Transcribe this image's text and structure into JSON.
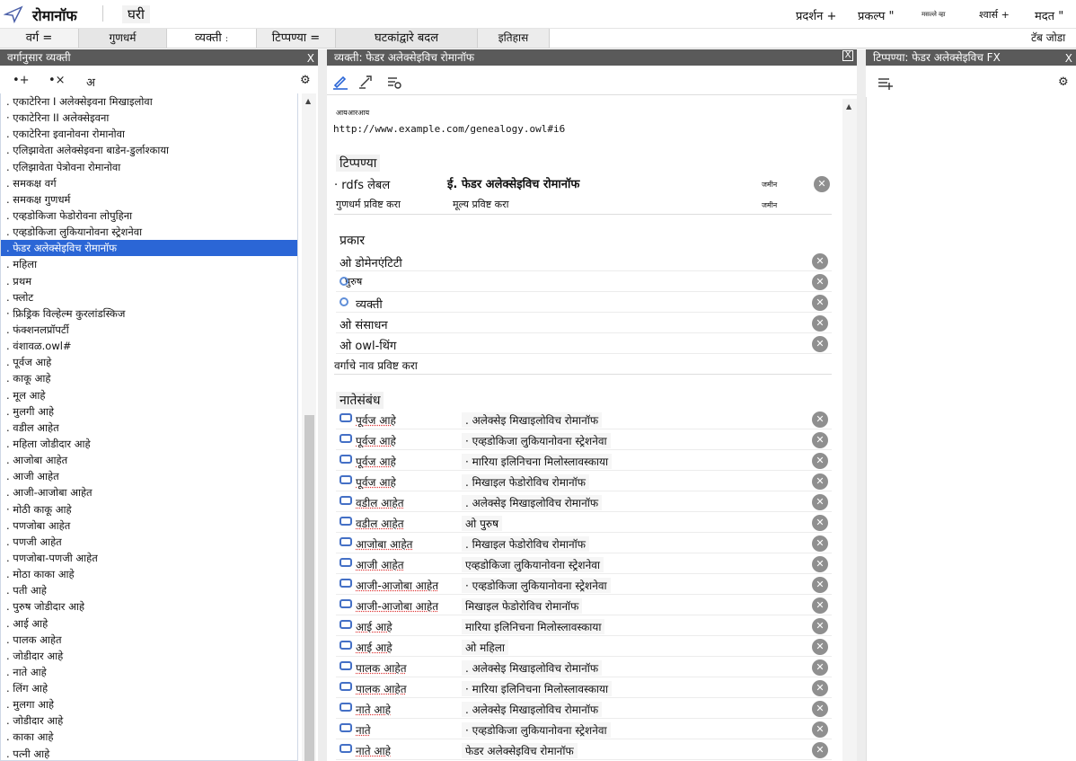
{
  "app": {
    "title": "रोमानॉफ",
    "home": "घरी"
  },
  "menus": {
    "display": "प्रदर्शन +",
    "project": "प्रकल्प \"",
    "tiny": "मसल्ले व्हा",
    "bookmarks": "श्वार्स +",
    "help": "मदत \""
  },
  "tabs": {
    "classes": "वर्ग =",
    "properties": "गुणधर्म",
    "individuals": "व्यक्ती",
    "individuals_mark": ":",
    "comments": "टिप्पण्या =",
    "changes": "घटकांद्वारे बदल",
    "history": "इतिहास",
    "add": "टॅब जोडा"
  },
  "left_panel": {
    "header": "वर्गानुसार व्यक्ती",
    "close": "X",
    "tools": {
      "add_individual": "•+",
      "delete_individual": "•×",
      "lang": "अ",
      "settings": "⚙"
    },
    "items": [
      ". एकाटेरिना I अलेक्सेइवना मिखाइलोवा",
      "· एकाटेरिना II अलेक्सेइवना",
      ". एकाटेरिना इवानोवना रोमानोवा",
      ". एलिझावेता अलेक्सेइवना बाडेन-डुर्लाश्काया",
      ". एलिझावेता पेत्रोवना रोमानोवा",
      ". समकक्ष वर्ग",
      ". समकक्ष गुणधर्म",
      ". एव्हडोकिजा फेडोरोवना लोपुहिना",
      ". एव्हडोकिजा लुकियानोवना स्ट्रेशनेवा",
      ". फेडर अलेक्सेइविच रोमानॉफ",
      ". महिला",
      ". प्रथम",
      ". फ्लोट",
      "· फ्रिड्रिक विल्हेल्म कुरलांडस्किज",
      ". फंक्शनलप्रॉपर्टी",
      ". वंशावळ.owl#",
      ". पूर्वज आहे",
      ". काकू आहे",
      ". मूल आहे",
      ". मुलगी आहे",
      ". वडील आहेत",
      ". महिला जोडीदार आहे",
      ". आजोबा आहेत",
      ". आजी आहेत",
      ". आजी-आजोबा आहेत",
      "· मोठी काकू आहे",
      ". पणजोबा आहेत",
      ". पणजी आहेत",
      ". पणजोबा-पणजी आहेत",
      ". मोठा काका आहे",
      ". पती आहे",
      ". पुरुष जोडीदार आहे",
      ". आई आहे",
      ". पालक आहेत",
      ". जोडीदार आहे",
      ". नाते आहे",
      ". लिंग आहे",
      ". मुलगा आहे",
      ". जोडीदार आहे",
      ". काका आहे",
      ". पत्नी आहे"
    ],
    "selected_index": 9
  },
  "middle_panel": {
    "header": "व्यक्ती: फेडर अलेक्सेइविच रोमानॉफ",
    "close": "X",
    "iri_label": "आयआरआय",
    "iri": "http://www.example.com/genealogy.owl#i6",
    "annotations": {
      "title": "टिप्पण्या",
      "prop": "· rdfs लेबल",
      "value": "ई. फेडर अलेक्सेइविच रोमानॉफ",
      "lang": "जमीन",
      "enter_prop": "गुणधर्म प्रविष्ट करा",
      "enter_value": "मूल्य प्रविष्ट करा",
      "enter_lang": "जमीन"
    },
    "types": {
      "title": "प्रकार",
      "rows": [
        "ओ डोमेनएंटिटी",
        "पुरुष",
        "व्यक्ती",
        "ओ संसाधन",
        "ओ owl-थिंग"
      ],
      "enter": "वर्गाचे नाव प्रविष्ट करा"
    },
    "relations": {
      "title": "नातेसंबंध",
      "rows": [
        {
          "prop": "पूर्वज आहे",
          "value": ". अलेक्सेइ मिखाइलोविच रोमानॉफ"
        },
        {
          "prop": "पूर्वज आहे",
          "value": "· एव्हडोकिजा लुकियानोवना स्ट्रेशनेवा"
        },
        {
          "prop": "पूर्वज आहे",
          "value": "· मारिया इलिनिचना मिलोस्लावस्काया"
        },
        {
          "prop": "पूर्वज आहे",
          "value": ". मिखाइल फेडोरोविच रोमानॉफ"
        },
        {
          "prop": "वडील आहेत",
          "value": ". अलेक्सेइ मिखाइलोविच रोमानॉफ"
        },
        {
          "prop": "वडील आहेत",
          "value": "ओ पुरुष"
        },
        {
          "prop": "आजोबा आहेत",
          "value": ". मिखाइल फेडोरोविच रोमानॉफ"
        },
        {
          "prop": "आजी आहेत",
          "value": "एव्हडोकिजा लुकियानोवना स्ट्रेशनेवा"
        },
        {
          "prop": "आजी-आजोबा आहेत",
          "value": "· एव्हडोकिजा लुकियानोवना स्ट्रेशनेवा"
        },
        {
          "prop": "आजी-आजोबा आहेत",
          "value": "मिखाइल फेडोरोविच रोमानॉफ"
        },
        {
          "prop": "आई आहे",
          "value": "मारिया इलिनिचना मिलोस्लावस्काया"
        },
        {
          "prop": "आई आहे",
          "value": "ओ महिला"
        },
        {
          "prop": "पालक आहेत",
          "value": ". अलेक्सेइ मिखाइलोविच रोमानॉफ"
        },
        {
          "prop": "पालक आहेत",
          "value": "· मारिया इलिनिचना मिलोस्लावस्काया"
        },
        {
          "prop": "नाते आहे",
          "value": ". अलेक्सेइ मिखाइलोविच रोमानॉफ"
        },
        {
          "prop": "नाते",
          "value": "· एव्हडोकिजा लुकियानोवना स्ट्रेशनेवा"
        },
        {
          "prop": "नाते आहे",
          "value": "फेडर अलेक्सेइविच रोमानॉफ"
        }
      ]
    }
  },
  "right_panel": {
    "header": "टिप्पण्या: फेडर अलेक्सेइविच FX",
    "close": "X"
  },
  "colors": {
    "selection": "#2b66d6",
    "header_bg": "#5a5a5a",
    "accent": "#4470c6"
  }
}
